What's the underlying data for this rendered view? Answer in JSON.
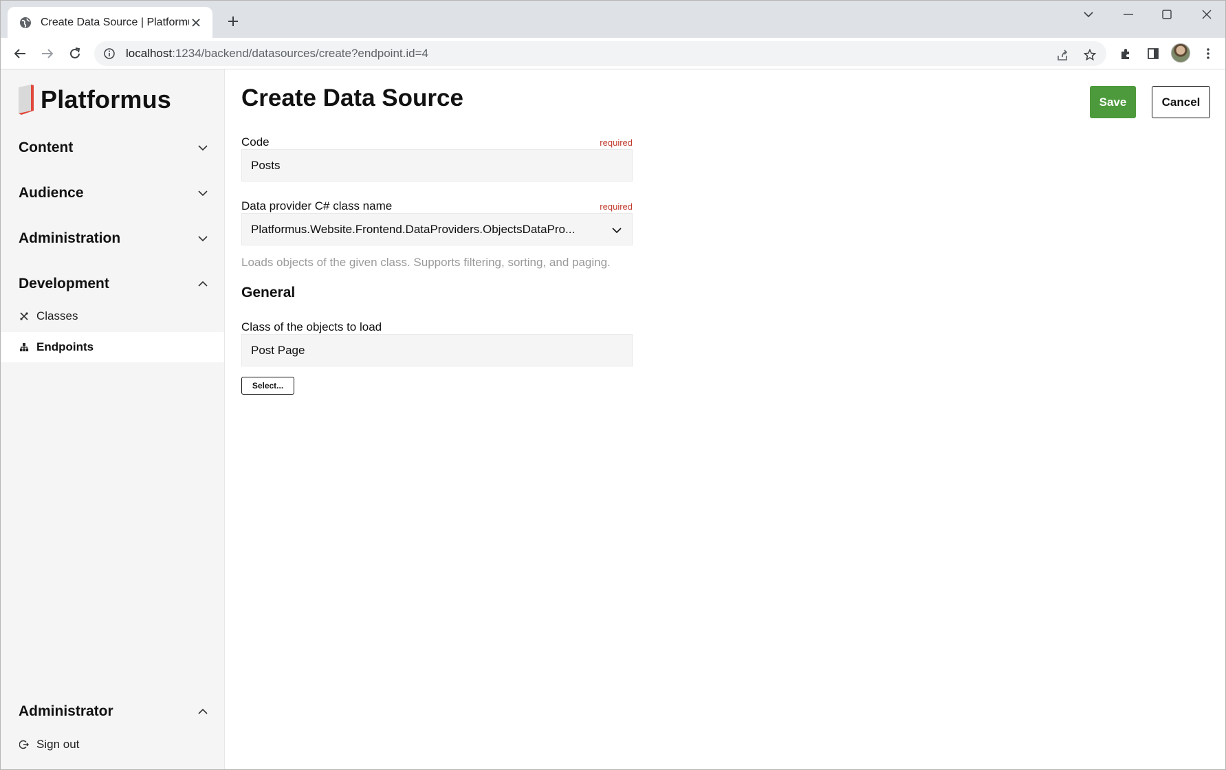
{
  "browser": {
    "tab_title": "Create Data Source | Platformus",
    "url_host": "localhost",
    "url_path": ":1234/backend/datasources/create?endpoint.id=4"
  },
  "app": {
    "logo_text": "Platformus",
    "brand_color": "#e0483b"
  },
  "sidebar": {
    "groups": [
      {
        "label": "Content",
        "expanded": false
      },
      {
        "label": "Audience",
        "expanded": false
      },
      {
        "label": "Administration",
        "expanded": false
      },
      {
        "label": "Development",
        "expanded": true,
        "items": [
          {
            "label": "Classes",
            "icon": "classes-icon",
            "active": false
          },
          {
            "label": "Endpoints",
            "icon": "endpoints-icon",
            "active": true
          }
        ]
      }
    ],
    "user_group": {
      "label": "Administrator",
      "expanded": true,
      "items": [
        {
          "label": "Sign out",
          "icon": "sign-out-icon"
        }
      ]
    }
  },
  "main": {
    "title": "Create Data Source",
    "save_label": "Save",
    "cancel_label": "Cancel",
    "save_color": "#4c9a3b",
    "fields": {
      "code": {
        "label": "Code",
        "required": "required",
        "value": "Posts"
      },
      "provider": {
        "label": "Data provider C# class name",
        "required": "required",
        "value": "Platformus.Website.Frontend.DataProviders.ObjectsDataPro..."
      },
      "provider_hint": "Loads objects of the given class. Supports filtering, sorting, and paging."
    },
    "section_general": "General",
    "class_field": {
      "label": "Class of the objects to load",
      "value": "Post Page"
    },
    "select_label": "Select..."
  }
}
